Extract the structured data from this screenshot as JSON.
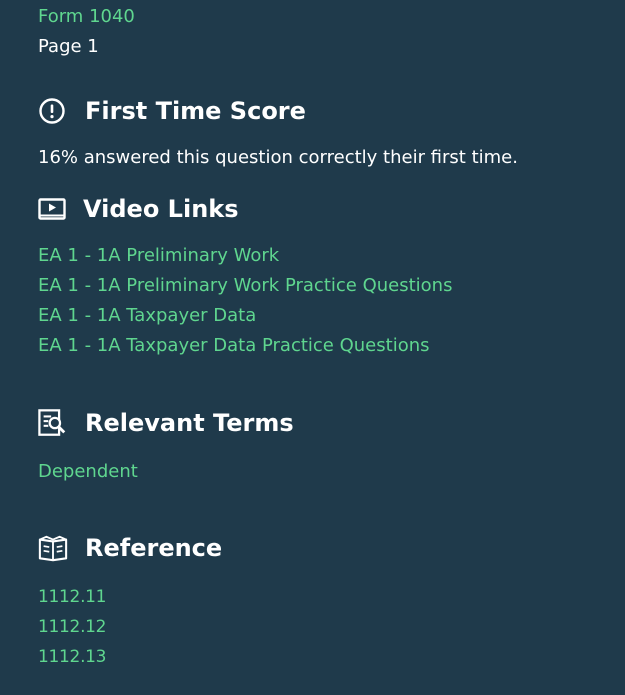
{
  "header": {
    "form_link": "Form 1040",
    "page_label": "Page 1"
  },
  "first_time_score": {
    "title": "First Time Score",
    "icon": "exclamation-circle-icon",
    "text": "16% answered this question correctly their first time."
  },
  "video_links": {
    "title": "Video Links",
    "icon": "video-play-icon",
    "items": [
      "EA 1 - 1A Preliminary Work",
      "EA 1 - 1A Preliminary Work Practice Questions",
      "EA 1 - 1A Taxpayer Data",
      "EA 1 - 1A Taxpayer Data Practice Questions"
    ]
  },
  "relevant_terms": {
    "title": "Relevant Terms",
    "icon": "document-search-icon",
    "items": [
      "Dependent"
    ]
  },
  "reference": {
    "title": "Reference",
    "icon": "open-book-icon",
    "items": [
      "1112.11",
      "1112.12",
      "1112.13"
    ]
  },
  "colors": {
    "background": "#1f3a4b",
    "link": "#5fd68f",
    "text": "#ffffff"
  }
}
